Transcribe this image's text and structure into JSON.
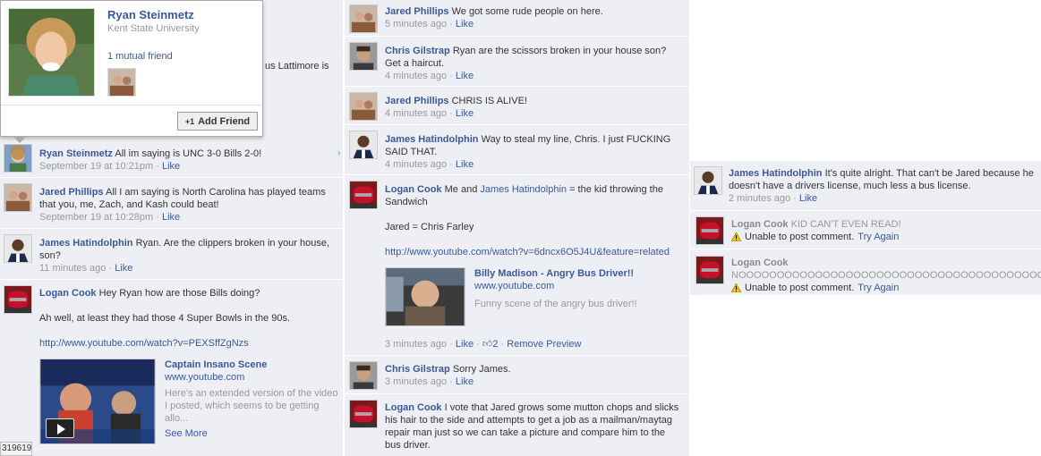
{
  "hovercard": {
    "name": "Ryan Steinmetz",
    "school": "Kent State University",
    "mutual": "1 mutual friend",
    "add_friend": "Add Friend",
    "add_icon": "+1"
  },
  "col1": {
    "partial_text": "us Lattimore is",
    "comments": [
      {
        "name": "Ryan Steinmetz",
        "text": "All im saying is UNC 3-0 Bills 2-0!",
        "time": "September 19 at 10:21pm",
        "like": "Like"
      },
      {
        "name": "Jared Phillips",
        "text": "All I am saying is North Carolina has played teams that you, me, Zach, and Kash could beat!",
        "time": "September 19 at 10:28pm",
        "like": "Like"
      },
      {
        "name": "James Hatindolphin",
        "text": "Ryan. Are the clippers broken in your house, son?",
        "time": "11 minutes ago",
        "like": "Like"
      },
      {
        "name": "Logan Cook",
        "text": "Hey Ryan how are those Bills doing?",
        "text2": "Ah well, at least they had those 4 Super Bowls in the 90s.",
        "link": "http://www.youtube.com/watch?v=PEXSffZgNzs",
        "video": {
          "title": "Captain Insano Scene",
          "domain": "www.youtube.com",
          "desc": "Here's an extended version of the video I posted, which seems to be getting allo...",
          "more": "See More"
        }
      }
    ],
    "counter": "319619"
  },
  "col2": {
    "comments": [
      {
        "name": "Jared Phillips",
        "text": "We got some rude people on here.",
        "time": "5 minutes ago",
        "like": "Like"
      },
      {
        "name": "Chris Gilstrap",
        "text": "Ryan are the scissors broken in your house son? Get a haircut.",
        "time": "4 minutes ago",
        "like": "Like"
      },
      {
        "name": "Jared Phillips",
        "text": "CHRIS IS ALIVE!",
        "time": "4 minutes ago",
        "like": "Like"
      },
      {
        "name": "James Hatindolphin",
        "text": "Way to steal my line, Chris. I just FUCKING SAID THAT.",
        "time": "4 minutes ago",
        "like": "Like"
      },
      {
        "name": "Logan Cook",
        "text_pre": "Me and",
        "mention": "James Hatindolphin",
        "text_post": "= the kid throwing the Sandwich",
        "text2": "Jared = Chris Farley",
        "link": "http://www.youtube.com/watch?v=6dncx6O5J4U&feature=related",
        "video": {
          "title": "Billy Madison - Angry Bus Driver!!",
          "domain": "www.youtube.com",
          "desc": "Funny scene of the angry bus driver!!"
        },
        "time": "3 minutes ago",
        "like": "Like",
        "likes_count": "2",
        "remove": "Remove Preview"
      },
      {
        "name": "Chris Gilstrap",
        "text": "Sorry James.",
        "time": "3 minutes ago",
        "like": "Like"
      },
      {
        "name": "Logan Cook",
        "text": "I vote that Jared grows some mutton chops and slicks his hair to the side and attempts to get a job as a mailman/maytag repair man just so we can take a picture and compare him to the bus driver."
      }
    ]
  },
  "col3": {
    "comments": [
      {
        "name": "James Hatindolphin",
        "text": "It's quite alright. That can't be Jared because he doesn't have a drivers license, much less a bus license.",
        "time": "2 minutes ago",
        "like": "Like"
      },
      {
        "name": "Logan Cook",
        "text": "KID CAN'T EVEN READ!",
        "error": "Unable to post comment.",
        "retry": "Try Again"
      },
      {
        "name": "Logan Cook",
        "text": "NOOOOOOOOOOOOOOOOOOOOOOOOOOOOOOOOOOOOOOOO!",
        "error": "Unable to post comment.",
        "retry": "Try Again"
      }
    ]
  },
  "sep": " · "
}
